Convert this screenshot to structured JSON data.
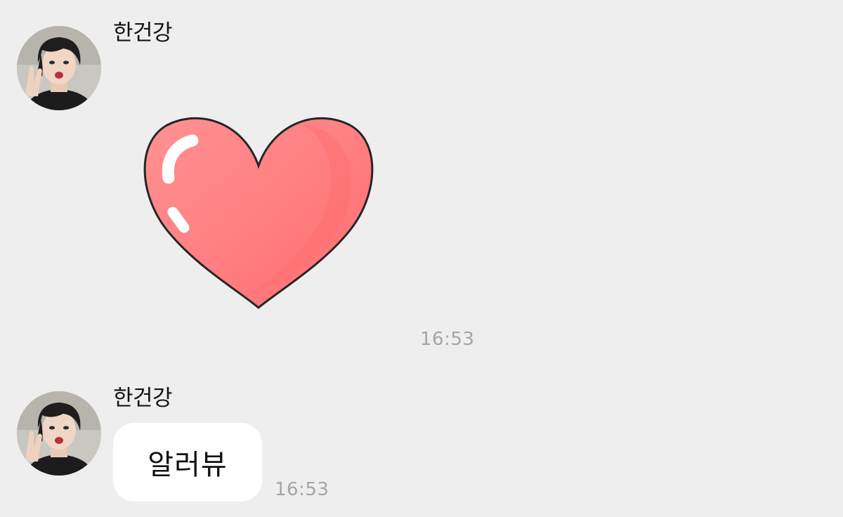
{
  "colors": {
    "background": "#eeeeee",
    "bubble": "#ffffff",
    "timestamp": "#a5a5a5",
    "heart": "#ff7f80"
  },
  "messages": [
    {
      "sender": "한건강",
      "type": "sticker",
      "sticker_icon": "heart-sticker-icon",
      "time": "16:53"
    },
    {
      "sender": "한건강",
      "type": "text",
      "text": "알러뷰",
      "time": "16:53"
    }
  ]
}
